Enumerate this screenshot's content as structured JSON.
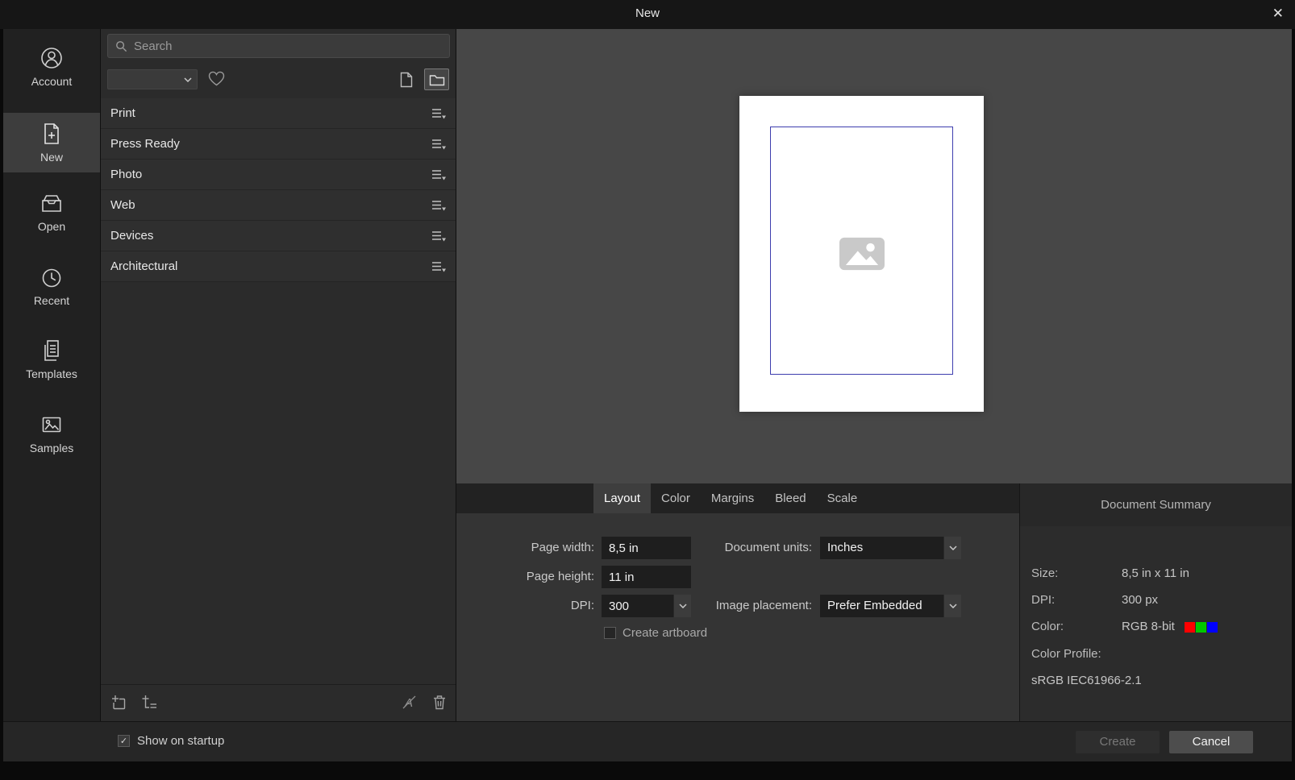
{
  "window": {
    "title": "New"
  },
  "icons": {
    "close": "✕",
    "check": "✓"
  },
  "sidebar": {
    "items": [
      {
        "label": "Account"
      },
      {
        "label": "New"
      },
      {
        "label": "Open"
      },
      {
        "label": "Recent"
      },
      {
        "label": "Templates"
      },
      {
        "label": "Samples"
      }
    ]
  },
  "presets": {
    "search_placeholder": "Search",
    "categories": [
      "Print",
      "Press Ready",
      "Photo",
      "Web",
      "Devices",
      "Architectural"
    ]
  },
  "tabs": [
    "Layout",
    "Color",
    "Margins",
    "Bleed",
    "Scale"
  ],
  "form": {
    "page_width_label": "Page width:",
    "page_width_value": "8,5 in",
    "page_height_label": "Page height:",
    "page_height_value": "11 in",
    "dpi_label": "DPI:",
    "dpi_value": "300",
    "document_units_label": "Document units:",
    "document_units_value": "Inches",
    "image_placement_label": "Image placement:",
    "image_placement_value": "Prefer Embedded",
    "create_artboard_label": "Create artboard"
  },
  "summary": {
    "title": "Document Summary",
    "size_label": "Size:",
    "size_value": "8,5 in  x  11 in",
    "dpi_label": "DPI:",
    "dpi_value": "300 px",
    "color_label": "Color:",
    "color_value": "RGB 8-bit",
    "swatches": {
      "red": "#ff0000",
      "green": "#00c800",
      "blue": "#0000ff"
    },
    "profile_label": "Color Profile:",
    "profile_value": "sRGB IEC61966-2.1"
  },
  "footer": {
    "show_on_startup_label": "Show on startup",
    "create_label": "Create",
    "cancel_label": "Cancel"
  }
}
